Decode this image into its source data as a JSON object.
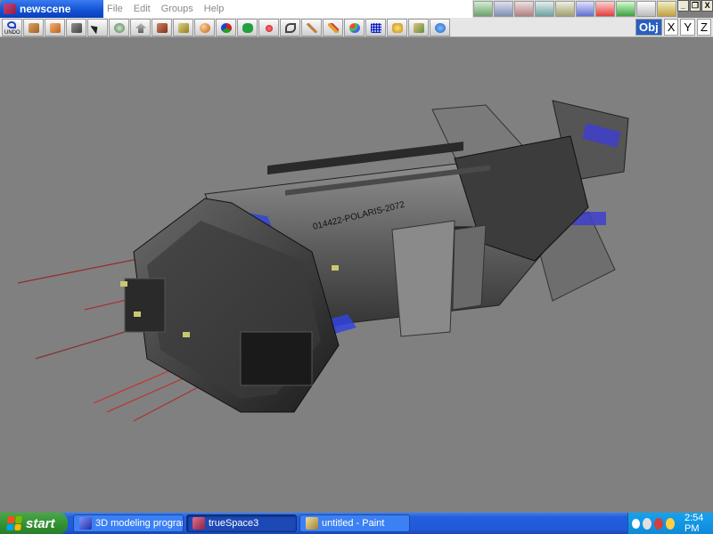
{
  "window": {
    "title": "newscene"
  },
  "menu": {
    "items": [
      "File",
      "Edit",
      "Groups",
      "Help"
    ]
  },
  "window_controls": [
    "_",
    "❐",
    "X"
  ],
  "toolbar": {
    "undo_label": "UNDO",
    "tool_icons": [
      "undo-icon",
      "object-tool-icon",
      "cube-tool-icon",
      "camera-tool-icon",
      "select-arrow-icon",
      "rotate-tool-icon",
      "move-up-icon",
      "box-primitive-icon",
      "cone-primitive-icon",
      "sphere-primitive-icon",
      "paint-icon",
      "metaball-icon",
      "light-icon",
      "path-icon",
      "knife-icon",
      "brush-icon",
      "material-icon",
      "grid-icon",
      "group-icon",
      "terrain-icon",
      "3d-view-icon"
    ],
    "axis_buttons": [
      "Obj",
      "X",
      "Y",
      "Z"
    ]
  },
  "colors": {
    "accent": "#2158d8",
    "viewport_bg": "#808080",
    "start_green": "#318f31",
    "hull_blue": "#3344dd"
  },
  "viewport": {
    "hull_text": "014422-POLARIS-2072"
  },
  "taskbar": {
    "start_label": "start",
    "tasks": [
      {
        "label": "3D modeling program..."
      },
      {
        "label": "trueSpace3"
      },
      {
        "label": "untitled - Paint"
      }
    ],
    "clock": "2:54 PM"
  }
}
